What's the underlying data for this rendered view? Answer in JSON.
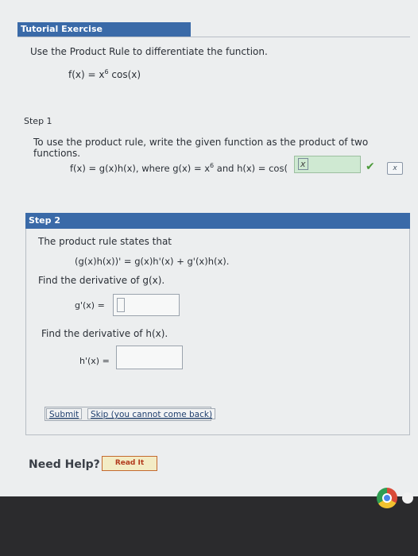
{
  "header": {
    "title": "Tutorial Exercise"
  },
  "problem": {
    "instruction": "Use the Product Rule to differentiate the function.",
    "function_lhs": "f(x) = x",
    "function_exp": "6",
    "function_rhs": " cos(x)"
  },
  "step1": {
    "label": "Step 1",
    "text": "To use the product rule, write the given function as the product of two functions.",
    "eq_part1": "f(x) = g(x)h(x), where g(x) = x",
    "eq_exp": "6",
    "eq_part2": " and h(x) = cos(",
    "answer": "x",
    "keyboard_icon_label": "x"
  },
  "step2": {
    "label": "Step 2",
    "rule_text": "The product rule states that",
    "rule_eq": "(g(x)h(x))' = g(x)h'(x) + g'(x)h(x).",
    "find_g": "Find the derivative of g(x).",
    "g_label": "g'(x) =",
    "g_value": "",
    "find_h": "Find the derivative of h(x).",
    "h_label": "h'(x) =",
    "h_value": "",
    "submit_label": "Submit",
    "skip_label": "Skip (you cannot come back)"
  },
  "help": {
    "label": "Need Help?",
    "read_it": "Read It"
  },
  "colors": {
    "accent": "#3a6aa8",
    "correct": "#4c9a3a",
    "answer_bg": "#cfe9d2"
  }
}
